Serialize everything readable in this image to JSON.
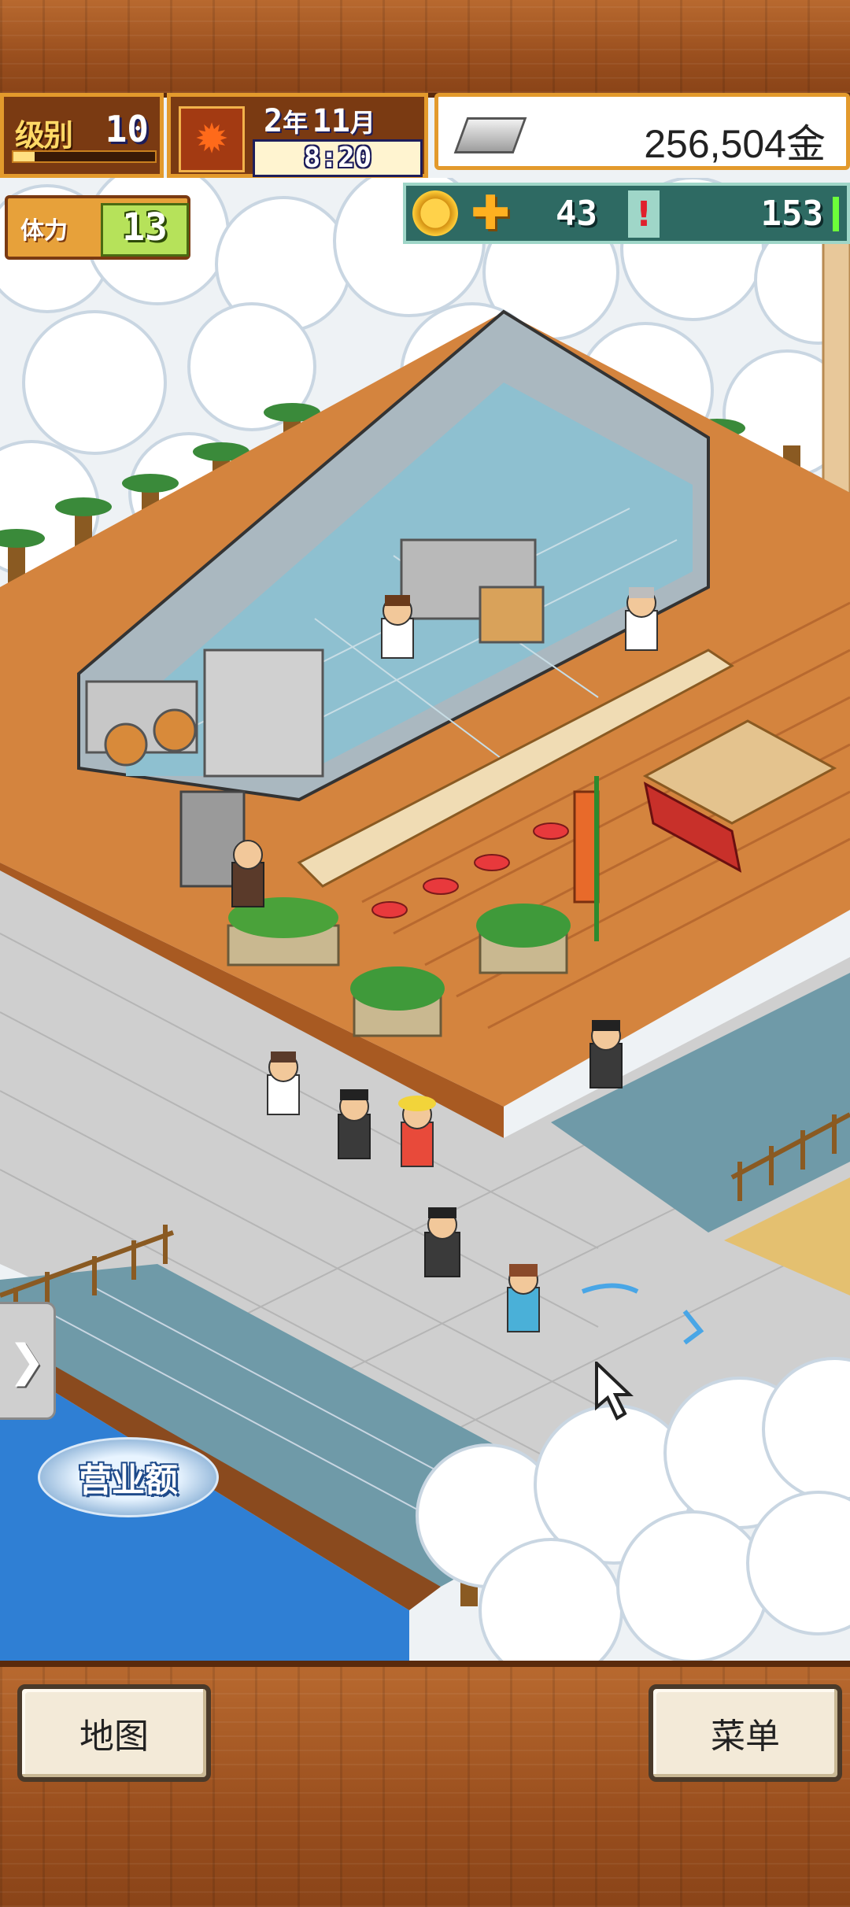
{
  "hud": {
    "level": {
      "label": "级别",
      "value": "10",
      "progress": 0.15
    },
    "date": {
      "year": "2",
      "year_unit": "年",
      "month": "11",
      "month_unit": "月",
      "time": "8:20",
      "season_icon": "maple-leaf-icon"
    },
    "money": {
      "value": "256,504金",
      "icon": "silver-bar-icon"
    },
    "stamina": {
      "label": "体力",
      "value": "13"
    },
    "points": {
      "coin_value": "43",
      "research_value": "153",
      "coin_icon": "coin-icon",
      "plus_icon": "plus-icon",
      "alert_icon": "exclamation-icon"
    }
  },
  "world": {
    "sales_label": "营业额",
    "side_toggle_icon": "chevron-right-icon"
  },
  "bottom_bar": {
    "map_label": "地图",
    "menu_label": "菜单"
  },
  "colors": {
    "wood": "#9a4f1e",
    "hud_orange": "#e39a2c",
    "points_teal": "#2e6a63",
    "snow": "#eef2f5"
  }
}
